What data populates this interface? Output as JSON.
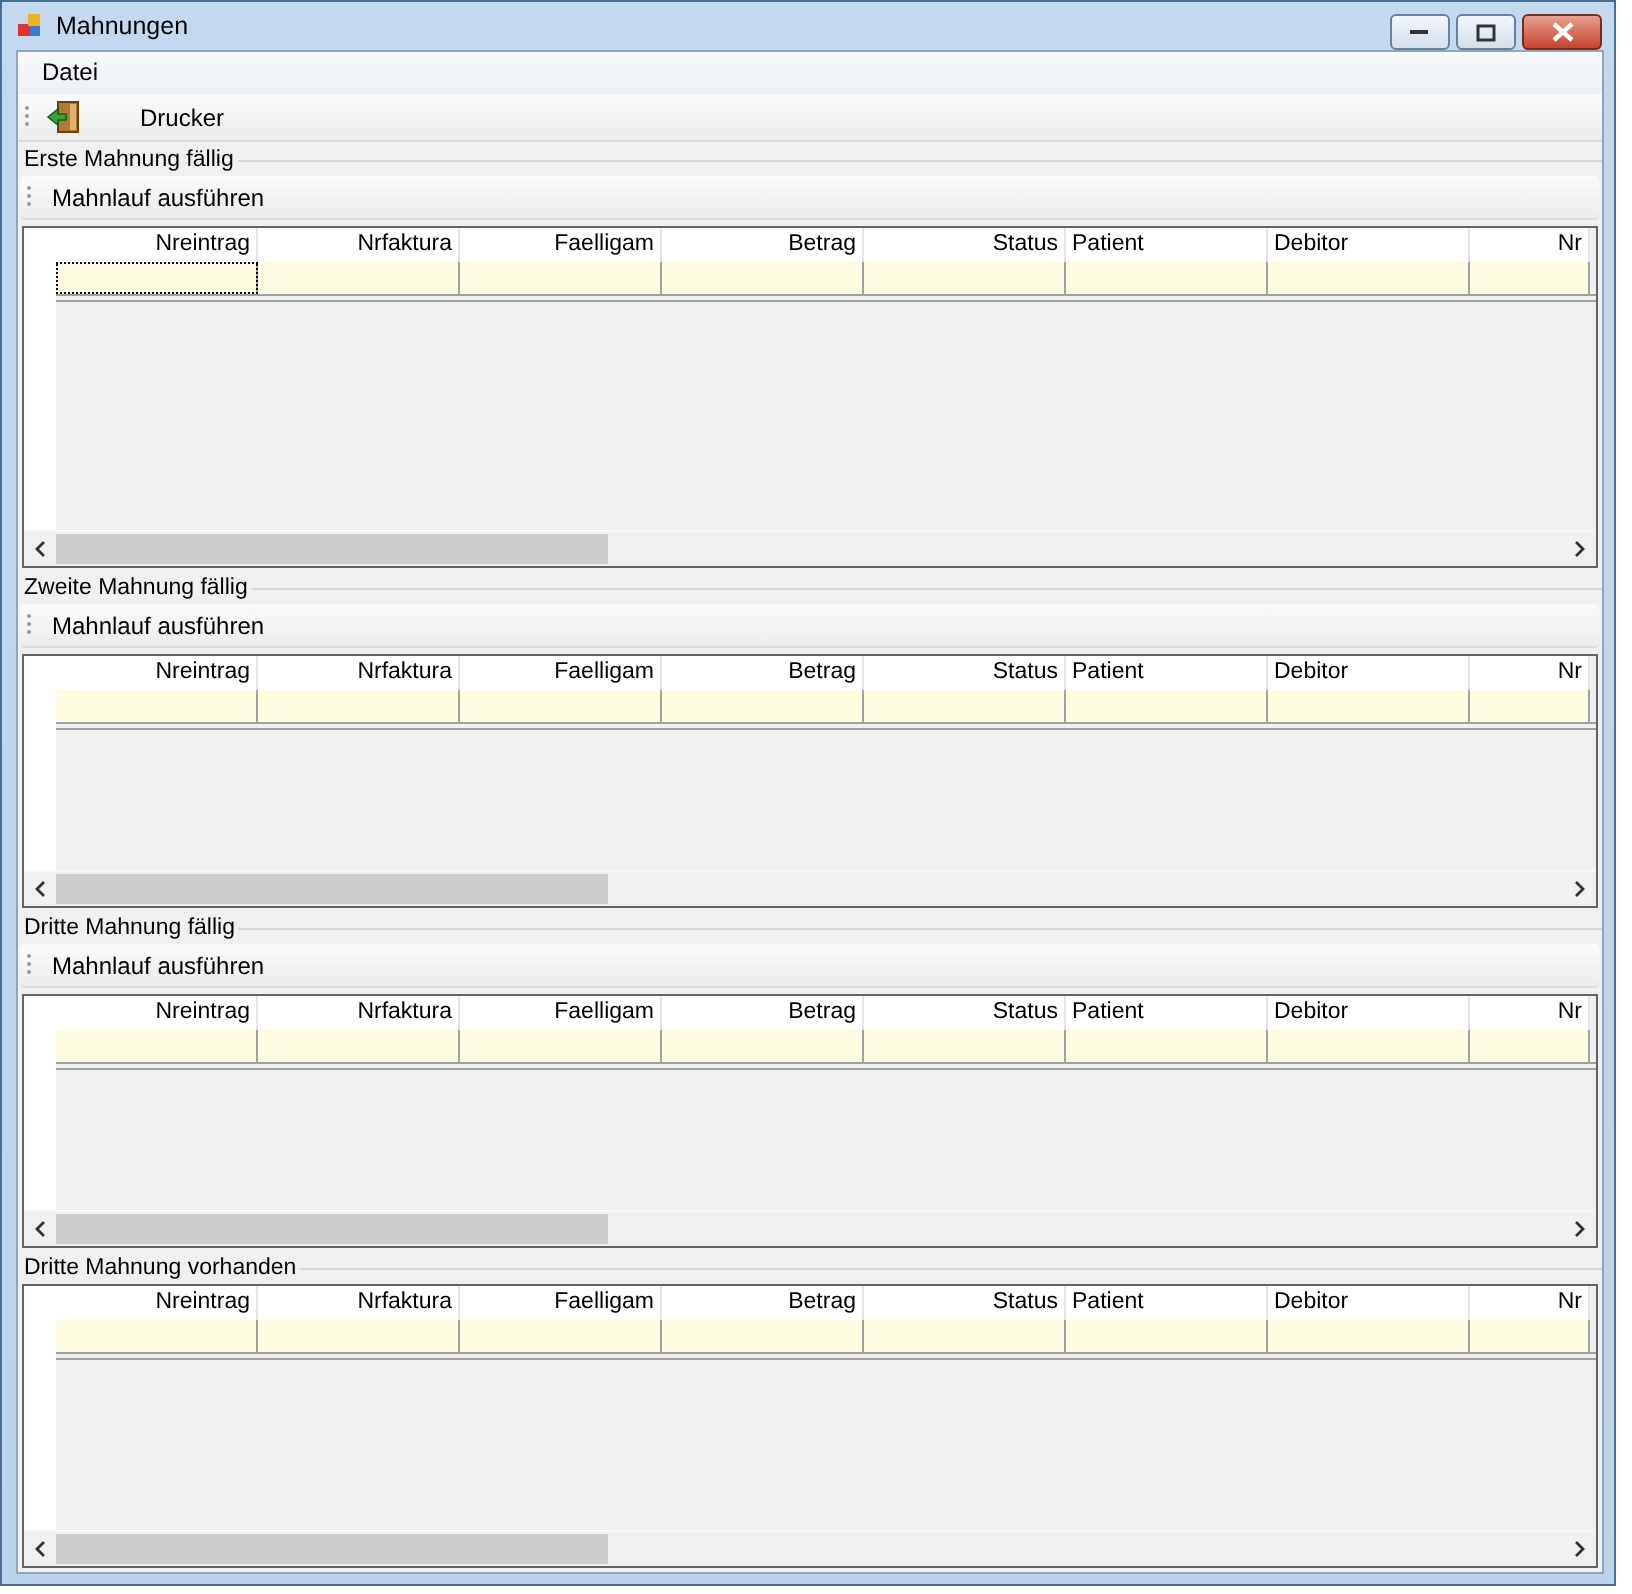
{
  "window": {
    "title": "Mahnungen"
  },
  "menu": [
    "Datei"
  ],
  "toolbar": {
    "button": "Drucker"
  },
  "sections": [
    {
      "title": "Erste Mahnung fällig",
      "action": "Mahnlauf ausführen",
      "focused_cell": true,
      "columns": [
        "Nreintrag",
        "Nrfaktura",
        "Faelligam",
        "Betrag",
        "Status",
        "Patient",
        "Debitor",
        "Nr"
      ]
    },
    {
      "title": "Zweite Mahnung fällig",
      "action": "Mahnlauf ausführen",
      "focused_cell": false,
      "columns": [
        "Nreintrag",
        "Nrfaktura",
        "Faelligam",
        "Betrag",
        "Status",
        "Patient",
        "Debitor",
        "Nr"
      ]
    },
    {
      "title": "Dritte Mahnung fällig",
      "action": "Mahnlauf ausführen",
      "focused_cell": false,
      "columns": [
        "Nreintrag",
        "Nrfaktura",
        "Faelligam",
        "Betrag",
        "Status",
        "Patient",
        "Debitor",
        "Nr"
      ]
    },
    {
      "title": "Dritte Mahnung vorhanden",
      "focused_cell": false,
      "columns": [
        "Nreintrag",
        "Nrfaktura",
        "Faelligam",
        "Betrag",
        "Status",
        "Patient",
        "Debitor",
        "Nr"
      ]
    }
  ]
}
